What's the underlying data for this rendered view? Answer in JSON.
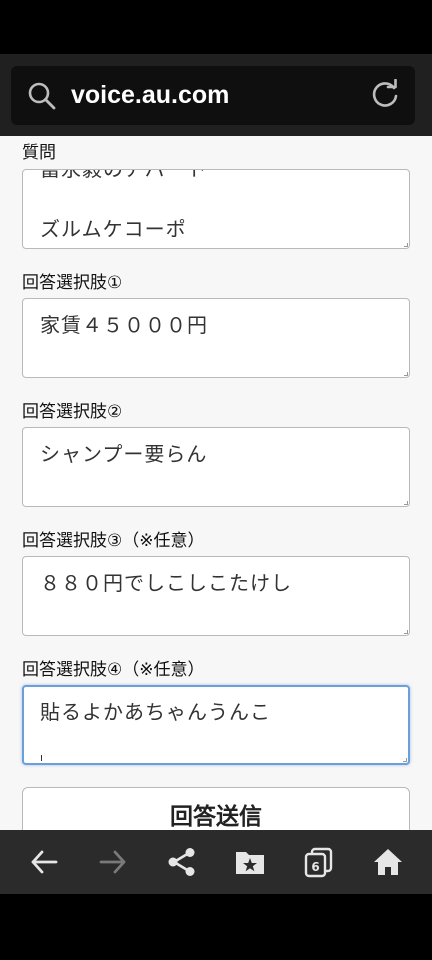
{
  "browser": {
    "url": "voice.au.com",
    "tab_count": "6"
  },
  "form": {
    "question_label": "質問",
    "question_value": "冨永毅のアパート\n\nズルムケコーポ",
    "choice1_label": "回答選択肢①",
    "choice1_value": "家賃４５０００円",
    "choice2_label": "回答選択肢②",
    "choice2_value": "シャンプー要らん",
    "choice3_label": "回答選択肢③（※任意）",
    "choice3_value": "８８０円でしこしこたけし",
    "choice4_label": "回答選択肢④（※任意）",
    "choice4_value": "貼るよかあちゃんうんこ",
    "submit_label": "回答送信"
  },
  "icons": {
    "search": "search-icon",
    "reload": "reload-icon",
    "back": "back-arrow-icon",
    "forward": "forward-arrow-icon",
    "share": "share-icon",
    "bookmarks": "bookmark-folder-icon",
    "tabs": "tabs-icon",
    "home": "home-icon"
  },
  "colors": {
    "toolbar": "#202020",
    "url_bar": "#0f0f0f",
    "page_bg": "#f7f7f7",
    "focus_border": "#6b9fd8",
    "bottom_bar": "#2b2b2b"
  }
}
